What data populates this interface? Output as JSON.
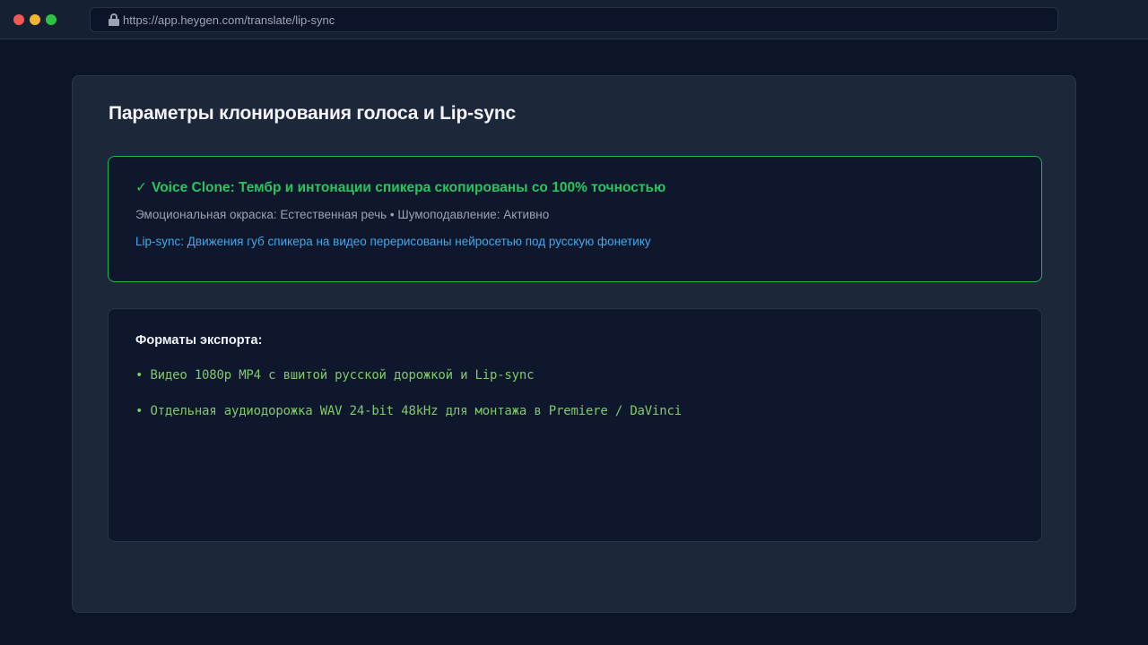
{
  "browser": {
    "url": "https://app.heygen.com/translate/lip-sync"
  },
  "page": {
    "title": "Параметры клонирования голоса и Lip-sync"
  },
  "voice_clone": {
    "check": "✓",
    "headline": "Voice Clone: Тембр и интонации спикера скопированы со 100% точностью",
    "meta": "Эмоциональная окраска: Естественная речь • Шумоподавление: Активно",
    "lipsync": "Lip-sync: Движения губ спикера на видео перерисованы нейросетью под русскую фонетику"
  },
  "export": {
    "title": "Форматы экспорта:",
    "items": [
      "• Видео 1080p MP4 с вшитой русской дорожкой и Lip-sync",
      "• Отдельная аудиодорожка WAV 24-bit 48kHz для монтажа в Premiere / DaVinci"
    ]
  },
  "colors": {
    "background": "#0c1527",
    "card": "#1c273a",
    "success_green": "#27c45f",
    "info_blue": "#45a7e8",
    "code_green": "#7fc96b"
  }
}
